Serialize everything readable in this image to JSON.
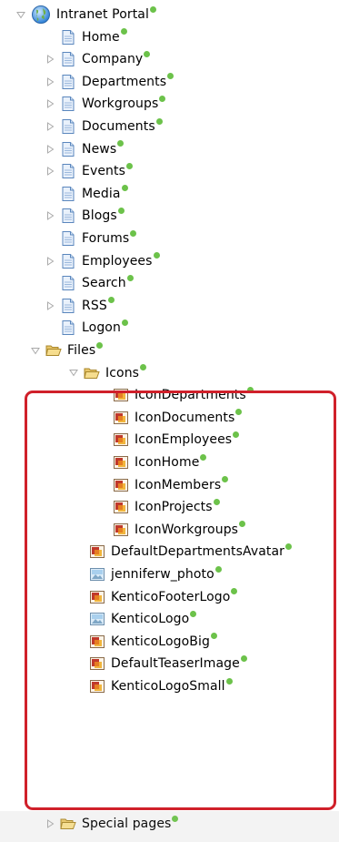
{
  "colors": {
    "status_dot": "#6cc24a",
    "highlight_border": "#d0202a"
  },
  "tree": {
    "root": {
      "label": "Intranet Portal",
      "icon": "globe-icon",
      "expanded": true
    },
    "items": [
      {
        "id": "home",
        "label": "Home",
        "icon": "page-icon",
        "expander": "none"
      },
      {
        "id": "company",
        "label": "Company",
        "icon": "page-icon",
        "expander": "collapsed"
      },
      {
        "id": "departments",
        "label": "Departments",
        "icon": "page-icon",
        "expander": "collapsed"
      },
      {
        "id": "workgroups",
        "label": "Workgroups",
        "icon": "page-icon",
        "expander": "collapsed"
      },
      {
        "id": "documents",
        "label": "Documents",
        "icon": "page-icon",
        "expander": "collapsed"
      },
      {
        "id": "news",
        "label": "News",
        "icon": "page-icon",
        "expander": "collapsed"
      },
      {
        "id": "events",
        "label": "Events",
        "icon": "page-icon",
        "expander": "collapsed"
      },
      {
        "id": "media",
        "label": "Media",
        "icon": "page-icon",
        "expander": "none"
      },
      {
        "id": "blogs",
        "label": "Blogs",
        "icon": "page-icon",
        "expander": "collapsed"
      },
      {
        "id": "forums",
        "label": "Forums",
        "icon": "page-icon",
        "expander": "none"
      },
      {
        "id": "employees",
        "label": "Employees",
        "icon": "page-icon",
        "expander": "collapsed"
      },
      {
        "id": "search",
        "label": "Search",
        "icon": "page-icon",
        "expander": "none"
      },
      {
        "id": "rss",
        "label": "RSS",
        "icon": "page-icon",
        "expander": "collapsed"
      },
      {
        "id": "logon",
        "label": "Logon",
        "icon": "page-icon",
        "expander": "none"
      }
    ],
    "files": {
      "label": "Files",
      "icon": "folder-icon",
      "expanded": true,
      "icons_folder": {
        "label": "Icons",
        "icon": "folder-icon",
        "expanded": true,
        "children": [
          {
            "label": "IconDepartments",
            "icon": "image-file-icon"
          },
          {
            "label": "IconDocuments",
            "icon": "image-file-icon"
          },
          {
            "label": "IconEmployees",
            "icon": "image-file-icon"
          },
          {
            "label": "IconHome",
            "icon": "image-file-icon"
          },
          {
            "label": "IconMembers",
            "icon": "image-file-icon"
          },
          {
            "label": "IconProjects",
            "icon": "image-file-icon"
          },
          {
            "label": "IconWorkgroups",
            "icon": "image-file-icon"
          }
        ]
      },
      "children": [
        {
          "label": "DefaultDepartmentsAvatar",
          "icon": "image-file-icon"
        },
        {
          "label": "jenniferw_photo",
          "icon": "photo-file-icon"
        },
        {
          "label": "KenticoFooterLogo",
          "icon": "image-file-icon"
        },
        {
          "label": "KenticoLogo",
          "icon": "photo-file-icon"
        },
        {
          "label": "KenticoLogoBig",
          "icon": "image-file-icon"
        },
        {
          "label": "DefaultTeaserImage",
          "icon": "image-file-icon"
        },
        {
          "label": "KenticoLogoSmall",
          "icon": "image-file-icon"
        }
      ]
    },
    "special_pages": {
      "label": "Special pages",
      "icon": "folder-icon",
      "expander": "collapsed"
    }
  }
}
